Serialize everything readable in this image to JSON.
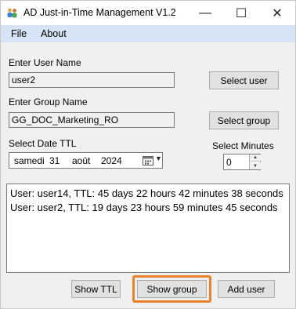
{
  "window": {
    "title": "AD Just-in-Time Management V1.2",
    "controls": {
      "minimize": "—",
      "maximize": "☐",
      "close": "✕"
    },
    "accent_highlight": "#e8822c",
    "menubar_color": "#d6e4f5"
  },
  "menu": {
    "file": "File",
    "about": "About"
  },
  "user": {
    "label": "Enter User Name",
    "value": "user2",
    "button": "Select user"
  },
  "group": {
    "label": "Enter Group Name",
    "value": "GG_DOC_Marketing_RO",
    "button": "Select group"
  },
  "date": {
    "label": "Select Date TTL",
    "weekday": "samedi",
    "day": "31",
    "month": "août",
    "year": "2024"
  },
  "minutes": {
    "label": "Select Minutes",
    "value": "0"
  },
  "output": {
    "lines": [
      "User: user14, TTL:  45 days 22 hours 42 minutes 38 seconds",
      "User: user2, TTL:  19 days 23 hours 59 minutes 45 seconds"
    ]
  },
  "buttons": {
    "show_ttl": "Show TTL",
    "show_group": "Show group",
    "add_user": "Add user"
  }
}
